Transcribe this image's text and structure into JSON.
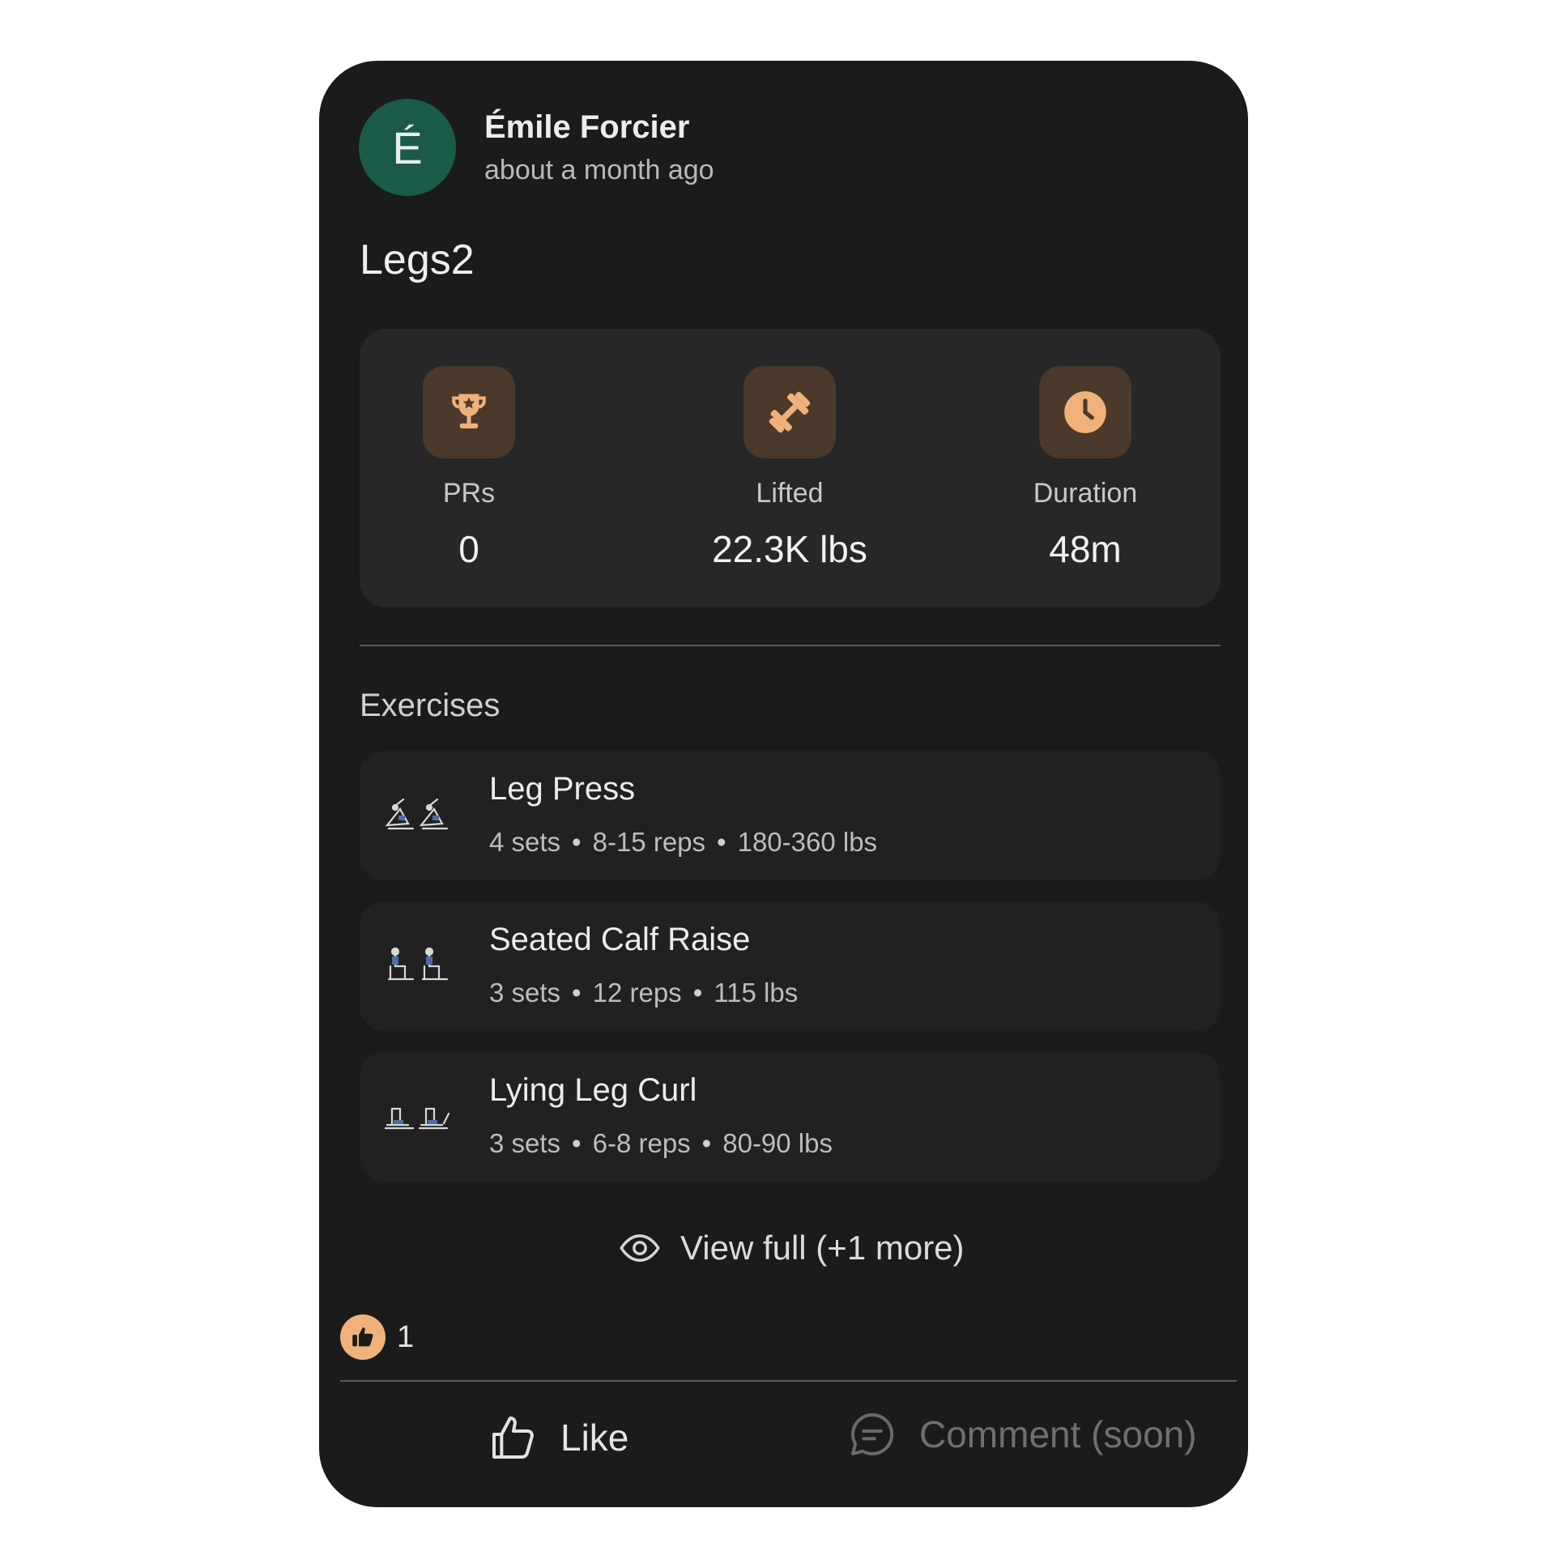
{
  "post": {
    "avatar_initial": "É",
    "avatar_color": "#1a5a48",
    "author": "Émile Forcier",
    "time": "about a month ago",
    "title": "Legs2"
  },
  "stats": [
    {
      "icon": "trophy-icon",
      "label": "PRs",
      "value": "0"
    },
    {
      "icon": "dumbbell-icon",
      "label": "Lifted",
      "value": "22.3K lbs"
    },
    {
      "icon": "clock-icon",
      "label": "Duration",
      "value": "48m"
    }
  ],
  "exercises_heading": "Exercises",
  "exercises": [
    {
      "name": "Leg Press",
      "sets": "4 sets",
      "reps": "8-15 reps",
      "weight": "180-360 lbs"
    },
    {
      "name": "Seated Calf Raise",
      "sets": "3 sets",
      "reps": "12 reps",
      "weight": "115 lbs"
    },
    {
      "name": "Lying Leg Curl",
      "sets": "3 sets",
      "reps": "6-8 reps",
      "weight": "80-90 lbs"
    }
  ],
  "separator": "•",
  "view_full_label": "View full (+1 more)",
  "like_count": "1",
  "actions": {
    "like_label": "Like",
    "comment_label": "Comment (soon)"
  },
  "colors": {
    "card_bg": "#1b1b1b",
    "accent": "#f0b27a",
    "icon_tile": "#4b3a2b"
  }
}
